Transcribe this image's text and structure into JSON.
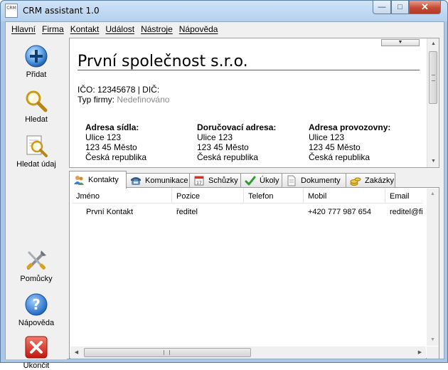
{
  "window": {
    "title": "CRM assistant 1.0",
    "app_icon_text": "CRM",
    "controls": {
      "minimize": "—",
      "maximize": "□",
      "close": "✕"
    }
  },
  "menu": [
    {
      "label": "Hlavní"
    },
    {
      "label": "Firma"
    },
    {
      "label": "Kontakt"
    },
    {
      "label": "Událost"
    },
    {
      "label": "Nástroje"
    },
    {
      "label": "Nápověda"
    }
  ],
  "toolbar": {
    "add": "Přidat",
    "search": "Hledat",
    "search_data": "Hledat údaj",
    "tools": "Pomůcky",
    "help": "Nápověda",
    "exit": "Ukončit"
  },
  "company": {
    "name": "První společnost s.r.o.",
    "ids_line": "IČO: 12345678 | DIČ:",
    "type_label": "Typ firmy:",
    "type_value": "Nedefinováno",
    "addresses": [
      {
        "heading": "Adresa sídla:",
        "street": "Ulice 123",
        "city": "123 45 Město",
        "country": "Česká republika"
      },
      {
        "heading": "Doručovací adresa:",
        "street": "Ulice 123",
        "city": "123 45 Město",
        "country": "Česká republika"
      },
      {
        "heading": "Adresa provozovny:",
        "street": "Ulice 123",
        "city": "123 45 Město",
        "country": "Česká republika"
      }
    ]
  },
  "tabs": [
    {
      "label": "Kontakty",
      "icon": "contacts-icon",
      "active": true
    },
    {
      "label": "Komunikace",
      "icon": "phone-icon"
    },
    {
      "label": "Schůzky",
      "icon": "calendar-icon"
    },
    {
      "label": "Úkoly",
      "icon": "check-icon"
    },
    {
      "label": "Dokumenty",
      "icon": "document-icon"
    },
    {
      "label": "Zakázky",
      "icon": "coins-icon"
    }
  ],
  "contacts": {
    "columns": [
      "Jméno",
      "Pozice",
      "Telefon",
      "Mobil",
      "Email"
    ],
    "rows": [
      [
        "První Kontakt",
        "ředitel",
        "",
        "+420 777 987 654",
        "reditel@firma"
      ]
    ]
  },
  "colors": {
    "accent_blue": "#2a6fc9",
    "help_blue": "#2c7bd6",
    "exit_red": "#d9261c"
  }
}
